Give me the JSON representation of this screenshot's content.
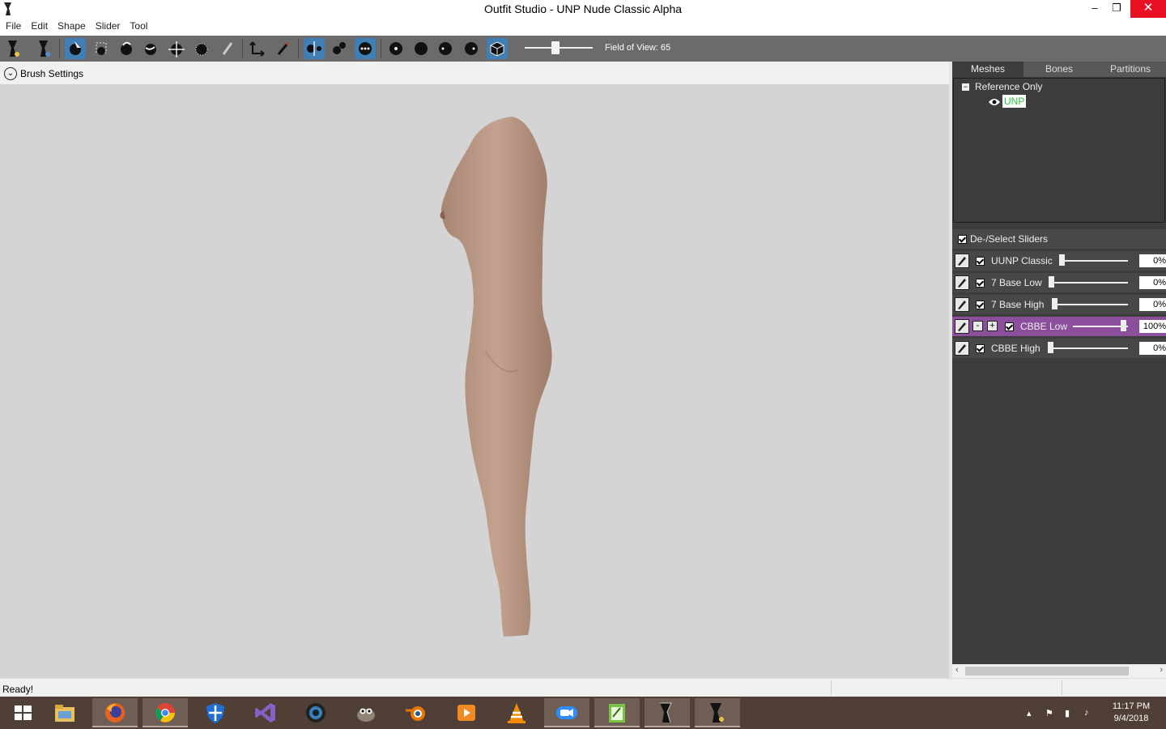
{
  "window": {
    "title": "Outfit Studio - UNP Nude Classic Alpha",
    "minimize": "–",
    "restore": "❐",
    "close": "✕"
  },
  "menu": [
    "File",
    "Edit",
    "Shape",
    "Slider",
    "Tool"
  ],
  "toolbar": {
    "fov_label": "Field of View: 65",
    "fov_value": 65
  },
  "brush_settings": {
    "label": "Brush Settings"
  },
  "right_panel": {
    "tabs": [
      "Meshes",
      "Bones",
      "Partitions"
    ],
    "selected_tab": "Meshes",
    "tree": {
      "group": "Reference Only",
      "mesh": "UNP"
    },
    "deselect_label": "De-/Select Sliders",
    "sliders": [
      {
        "name": "UUNP Classic",
        "value": "0%",
        "level": 0
      },
      {
        "name": "7 Base Low",
        "value": "0%",
        "level": 0
      },
      {
        "name": "7 Base High",
        "value": "0%",
        "level": 0
      },
      {
        "name": "CBBE Low",
        "value": "100%",
        "level": 100,
        "active": true,
        "minus": "-",
        "plus": "+"
      },
      {
        "name": "CBBE High",
        "value": "0%",
        "level": 0
      }
    ]
  },
  "status": {
    "text": "Ready!"
  },
  "taskbar": {
    "apps": [
      "windows-start",
      "file-explorer",
      "firefox",
      "chrome",
      "windows-defender",
      "visual-studio",
      "camera-app",
      "gimp",
      "blender",
      "media-player",
      "vlc",
      "zoom-app",
      "notepad-app",
      "outfit-studio-1",
      "outfit-studio-2"
    ],
    "clock_time": "11:17 PM",
    "clock_date": "9/4/2018"
  },
  "colors": {
    "accent": "#3f7fb5",
    "slider_active": "#8b4f9c",
    "panel": "#3d3d3d",
    "viewport": "#d4d4d4",
    "toolbar": "#6b6b6b",
    "unp_text": "#29c53a"
  }
}
